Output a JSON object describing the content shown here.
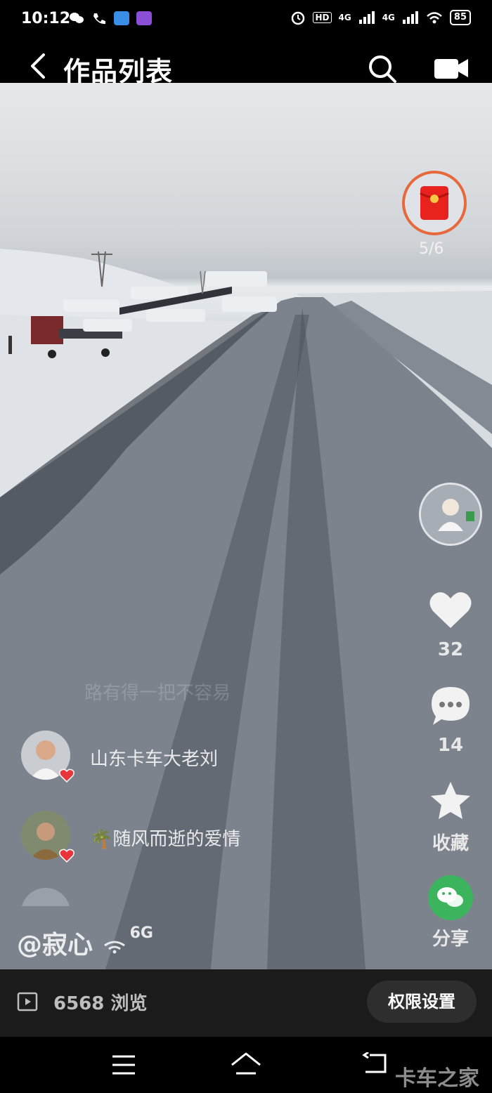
{
  "status_bar": {
    "time": "10:12",
    "network_left": "4G",
    "network_right": "4G",
    "hd": "HD",
    "battery": "85"
  },
  "header": {
    "title": "作品列表"
  },
  "video_overlay": {
    "red_packet_count": "5/6",
    "likes": "32",
    "comments": "14",
    "favorite_label": "收藏",
    "share_label": "分享",
    "faded_comment": "路有得一把不容易",
    "comments_list": [
      {
        "name": "山东卡车大老刘"
      },
      {
        "name": "🌴随风而逝的爱情"
      }
    ],
    "author": "@寂心",
    "author_suffix": "6G"
  },
  "bottom_bar": {
    "views_count": "6568",
    "views_label": "浏览",
    "permission_button": "权限设置"
  },
  "watermark": "卡车之家",
  "colors": {
    "accent_red": "#e7683b",
    "share_green": "#3bb45d"
  },
  "icons": [
    "back-icon",
    "search-icon",
    "camera-icon",
    "red-packet-icon",
    "heart-icon",
    "comment-icon",
    "star-icon",
    "wechat-icon",
    "play-icon",
    "menu-icon",
    "home-icon",
    "back-nav-icon"
  ]
}
